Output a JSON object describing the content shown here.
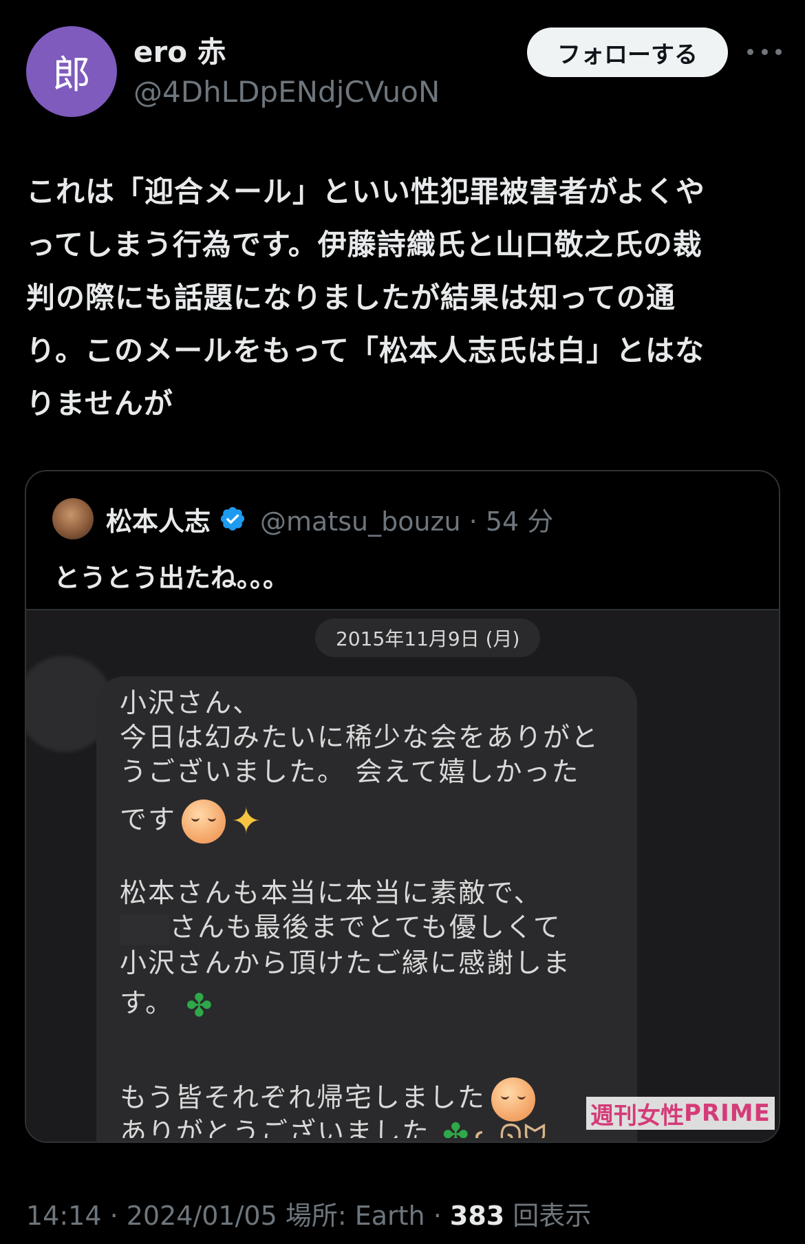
{
  "author": {
    "avatar_char": "郎",
    "display_name": "ero 赤",
    "handle": "@4DhLDpENdjCVuoN",
    "follow_label": "フォローする",
    "avatar_color": "#7e5bbd"
  },
  "tweet": {
    "lines": [
      "これは「迎合メール」といい性犯罪被害者がよくや",
      "ってしまう行為です。伊藤詩織氏と山口敬之氏の裁",
      "判の際にも話題になりましたが結果は知っての通",
      "り。このメールをもって「松本人志氏は白」とはな",
      "りませんが"
    ]
  },
  "quote": {
    "name": "松本人志",
    "handle_time": "@matsu_bouzu · 54 分",
    "text": "とうとう出たね。。。",
    "image": {
      "date": "2015年11月9日 (月)",
      "messages": [
        "小沢さん、",
        "今日は幻みたいに稀少な会をありがと",
        "うございました。 会えて嬉しかった",
        "です",
        "松本さんも本当に本当に素敵で、",
        "さんも最後までとても優しくて",
        "小沢さんから頂けたご縁に感謝しま",
        "す。",
        "もう皆それぞれ帰宅しました",
        "ありがとうございました"
      ],
      "watermark_a": "週刊女性",
      "watermark_b": "PRIME"
    }
  },
  "footer": {
    "time_date_place": "14:14 · 2024/01/05 場所: Earth · ",
    "views_count": "383",
    "views_label": " 回表示"
  },
  "icons": {
    "more": "more-horizontal-icon",
    "verified": "verified-badge-icon",
    "sparkles": "sparkles-icon",
    "clover": "four-leaf-clover-icon",
    "cat": "cat-icon"
  }
}
